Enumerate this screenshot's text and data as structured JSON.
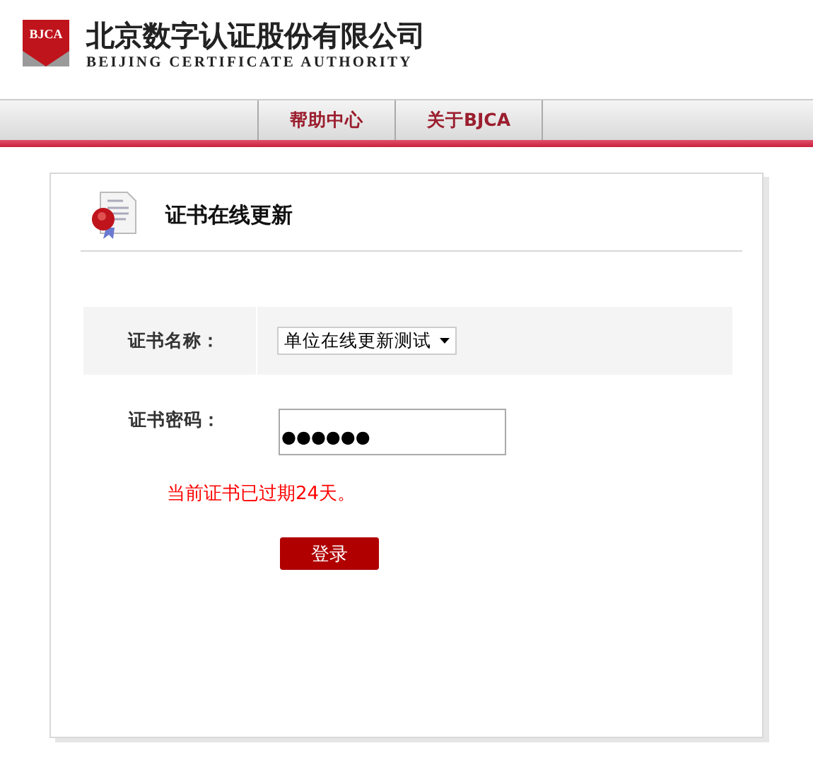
{
  "header": {
    "logo_text": "BJCA",
    "company_name": "北京数字认证股份有限公司",
    "company_name_en": "BEIJING CERTIFICATE AUTHORITY"
  },
  "nav": [
    {
      "label": "帮助中心",
      "selected": false
    },
    {
      "label": "关于BJCA",
      "selected": false
    }
  ],
  "form": {
    "title": "证书在线更新",
    "cert_name_label": "证书名称：",
    "cert_name_value": "单位在线更新测试",
    "password_label": "证书密码：",
    "password_value": "●●●●●●",
    "error": "当前证书已过期24天。",
    "login_button": "登录"
  }
}
